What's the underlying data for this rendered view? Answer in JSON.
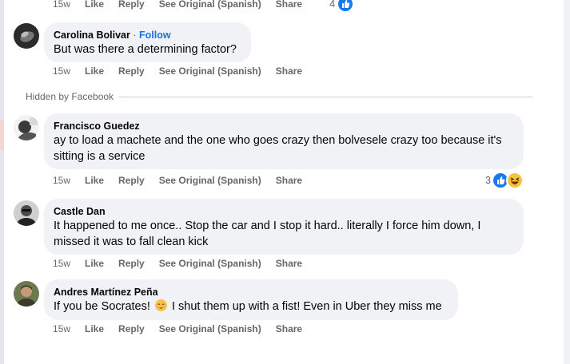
{
  "comments": [
    {
      "author": "",
      "text": "",
      "actions": {
        "time": "15w",
        "like": "Like",
        "reply": "Reply",
        "see_original": "See Original (Spanish)",
        "share": "Share"
      },
      "reactions": {
        "count": "4",
        "icons": [
          "like-icon"
        ]
      }
    },
    {
      "author": "Carolina Bolivar",
      "follow": "Follow",
      "separator": "·",
      "text": "But was there a determining factor?",
      "actions": {
        "time": "15w",
        "like": "Like",
        "reply": "Reply",
        "see_original": "See Original (Spanish)",
        "share": "Share"
      }
    },
    {
      "author": "Francisco Guedez",
      "text_lines": [
        "ay to load a machete and the one who goes crazy then bolvesele crazy too because it's",
        "sitting is a service"
      ],
      "actions": {
        "time": "15w",
        "like": "Like",
        "reply": "Reply",
        "see_original": "See Original (Spanish)",
        "share": "Share"
      },
      "reactions": {
        "count": "3",
        "icons": [
          "like-icon",
          "haha-icon"
        ]
      }
    },
    {
      "author": "Castle Dan",
      "text_lines": [
        "It happened to me once.. Stop the car and I stop it hard.. literally I force him down, I",
        "missed it was to fall clean kick"
      ],
      "actions": {
        "time": "15w",
        "like": "Like",
        "reply": "Reply",
        "see_original": "See Original (Spanish)",
        "share": "Share"
      }
    },
    {
      "author": "Andres Martínez Peña",
      "text_before_emoji": "If you be Socrates!",
      "emoji": "relieved-face-icon",
      "text_after_emoji": "I shut them up with a fist! Even in Uber they miss me",
      "actions": {
        "time": "15w",
        "like": "Like",
        "reply": "Reply",
        "see_original": "See Original (Spanish)",
        "share": "Share"
      }
    }
  ],
  "hidden_label": "Hidden by Facebook",
  "colors": {
    "link": "#216fdb",
    "muted": "#65676b",
    "bubble": "#f0f2f5",
    "like_blue": "#1877f2",
    "haha_yellow": "#f7c33b"
  }
}
